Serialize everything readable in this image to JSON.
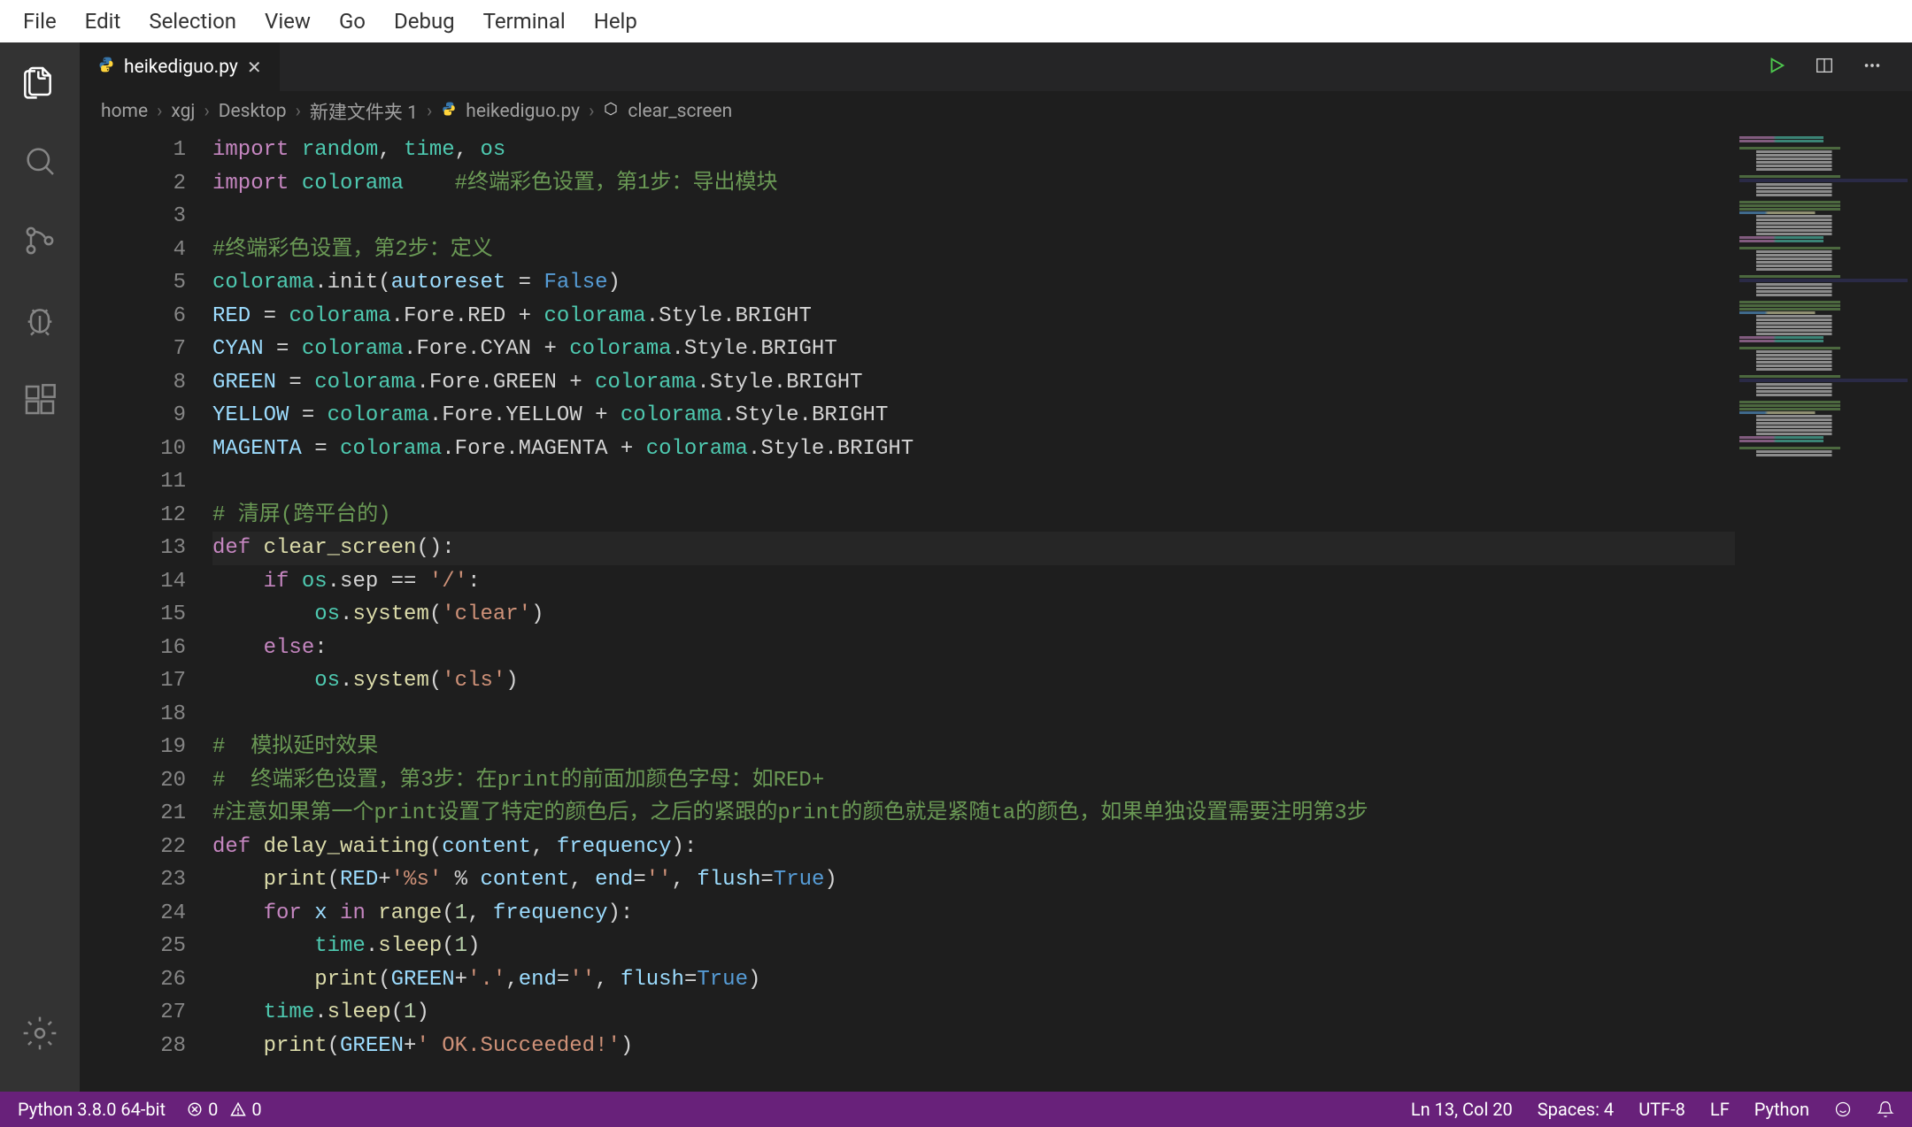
{
  "menubar": [
    "File",
    "Edit",
    "Selection",
    "View",
    "Go",
    "Debug",
    "Terminal",
    "Help"
  ],
  "tab": {
    "filename": "heikediguo.py"
  },
  "breadcrumb": {
    "parts": [
      "home",
      "xgj",
      "Desktop",
      "新建文件夹 1"
    ],
    "file": "heikediguo.py",
    "symbol": "clear_screen"
  },
  "code": {
    "lines": [
      {
        "n": 1,
        "seg": [
          [
            "kw",
            "import"
          ],
          [
            "op",
            " "
          ],
          [
            "mod",
            "random"
          ],
          [
            "op",
            ", "
          ],
          [
            "mod",
            "time"
          ],
          [
            "op",
            ", "
          ],
          [
            "mod",
            "os"
          ]
        ]
      },
      {
        "n": 2,
        "seg": [
          [
            "kw",
            "import"
          ],
          [
            "op",
            " "
          ],
          [
            "mod",
            "colorama"
          ],
          [
            "op",
            "    "
          ],
          [
            "com",
            "#终端彩色设置，第1步：导出模块"
          ]
        ]
      },
      {
        "n": 3,
        "seg": []
      },
      {
        "n": 4,
        "seg": [
          [
            "com",
            "#终端彩色设置，第2步：定义"
          ]
        ]
      },
      {
        "n": 5,
        "seg": [
          [
            "mod",
            "colorama"
          ],
          [
            "op",
            ".init("
          ],
          [
            "var",
            "autoreset"
          ],
          [
            "op",
            " = "
          ],
          [
            "const",
            "False"
          ],
          [
            "op",
            ")"
          ]
        ]
      },
      {
        "n": 6,
        "seg": [
          [
            "var",
            "RED"
          ],
          [
            "op",
            " = "
          ],
          [
            "mod",
            "colorama"
          ],
          [
            "op",
            ".Fore.RED + "
          ],
          [
            "mod",
            "colorama"
          ],
          [
            "op",
            ".Style.BRIGHT"
          ]
        ]
      },
      {
        "n": 7,
        "seg": [
          [
            "var",
            "CYAN"
          ],
          [
            "op",
            " = "
          ],
          [
            "mod",
            "colorama"
          ],
          [
            "op",
            ".Fore.CYAN + "
          ],
          [
            "mod",
            "colorama"
          ],
          [
            "op",
            ".Style.BRIGHT"
          ]
        ]
      },
      {
        "n": 8,
        "seg": [
          [
            "var",
            "GREEN"
          ],
          [
            "op",
            " = "
          ],
          [
            "mod",
            "colorama"
          ],
          [
            "op",
            ".Fore.GREEN + "
          ],
          [
            "mod",
            "colorama"
          ],
          [
            "op",
            ".Style.BRIGHT"
          ]
        ]
      },
      {
        "n": 9,
        "seg": [
          [
            "var",
            "YELLOW"
          ],
          [
            "op",
            " = "
          ],
          [
            "mod",
            "colorama"
          ],
          [
            "op",
            ".Fore.YELLOW + "
          ],
          [
            "mod",
            "colorama"
          ],
          [
            "op",
            ".Style.BRIGHT"
          ]
        ]
      },
      {
        "n": 10,
        "seg": [
          [
            "var",
            "MAGENTA"
          ],
          [
            "op",
            " = "
          ],
          [
            "mod",
            "colorama"
          ],
          [
            "op",
            ".Fore.MAGENTA + "
          ],
          [
            "mod",
            "colorama"
          ],
          [
            "op",
            ".Style.BRIGHT"
          ]
        ]
      },
      {
        "n": 11,
        "seg": []
      },
      {
        "n": 12,
        "seg": [
          [
            "com",
            "# 清屏(跨平台的)"
          ]
        ]
      },
      {
        "n": 13,
        "current": true,
        "seg": [
          [
            "kw",
            "def"
          ],
          [
            "op",
            " "
          ],
          [
            "fn",
            "clear_screen"
          ],
          [
            "op",
            "():"
          ]
        ]
      },
      {
        "n": 14,
        "seg": [
          [
            "op",
            "    "
          ],
          [
            "kw",
            "if"
          ],
          [
            "op",
            " "
          ],
          [
            "mod",
            "os"
          ],
          [
            "op",
            ".sep == "
          ],
          [
            "str",
            "'/'"
          ],
          [
            "op",
            ":"
          ]
        ]
      },
      {
        "n": 15,
        "seg": [
          [
            "op",
            "        "
          ],
          [
            "mod",
            "os"
          ],
          [
            "op",
            "."
          ],
          [
            "fn",
            "system"
          ],
          [
            "op",
            "("
          ],
          [
            "str",
            "'clear'"
          ],
          [
            "op",
            ")"
          ]
        ]
      },
      {
        "n": 16,
        "seg": [
          [
            "op",
            "    "
          ],
          [
            "kw",
            "else"
          ],
          [
            "op",
            ":"
          ]
        ]
      },
      {
        "n": 17,
        "seg": [
          [
            "op",
            "        "
          ],
          [
            "mod",
            "os"
          ],
          [
            "op",
            "."
          ],
          [
            "fn",
            "system"
          ],
          [
            "op",
            "("
          ],
          [
            "str",
            "'cls'"
          ],
          [
            "op",
            ")"
          ]
        ]
      },
      {
        "n": 18,
        "seg": []
      },
      {
        "n": 19,
        "seg": [
          [
            "com",
            "#  模拟延时效果"
          ]
        ]
      },
      {
        "n": 20,
        "seg": [
          [
            "com",
            "#  终端彩色设置，第3步：在print的前面加颜色字母：如RED+"
          ]
        ]
      },
      {
        "n": 21,
        "seg": [
          [
            "com",
            "#注意如果第一个print设置了特定的颜色后，之后的紧跟的print的颜色就是紧随ta的颜色，如果单独设置需要注明第3步"
          ]
        ]
      },
      {
        "n": 22,
        "seg": [
          [
            "kw",
            "def"
          ],
          [
            "op",
            " "
          ],
          [
            "fn",
            "delay_waiting"
          ],
          [
            "op",
            "("
          ],
          [
            "var",
            "content"
          ],
          [
            "op",
            ", "
          ],
          [
            "var",
            "frequency"
          ],
          [
            "op",
            "):"
          ]
        ]
      },
      {
        "n": 23,
        "seg": [
          [
            "op",
            "    "
          ],
          [
            "builtin",
            "print"
          ],
          [
            "op",
            "("
          ],
          [
            "var",
            "RED"
          ],
          [
            "op",
            "+"
          ],
          [
            "str",
            "'%s'"
          ],
          [
            "op",
            " % "
          ],
          [
            "var",
            "content"
          ],
          [
            "op",
            ", "
          ],
          [
            "var",
            "end"
          ],
          [
            "op",
            "="
          ],
          [
            "str",
            "''"
          ],
          [
            "op",
            ", "
          ],
          [
            "var",
            "flush"
          ],
          [
            "op",
            "="
          ],
          [
            "const",
            "True"
          ],
          [
            "op",
            ")"
          ]
        ]
      },
      {
        "n": 24,
        "seg": [
          [
            "op",
            "    "
          ],
          [
            "kw",
            "for"
          ],
          [
            "op",
            " "
          ],
          [
            "var",
            "x"
          ],
          [
            "op",
            " "
          ],
          [
            "kw",
            "in"
          ],
          [
            "op",
            " "
          ],
          [
            "builtin",
            "range"
          ],
          [
            "op",
            "("
          ],
          [
            "num",
            "1"
          ],
          [
            "op",
            ", "
          ],
          [
            "var",
            "frequency"
          ],
          [
            "op",
            "):"
          ]
        ]
      },
      {
        "n": 25,
        "seg": [
          [
            "op",
            "        "
          ],
          [
            "mod",
            "time"
          ],
          [
            "op",
            "."
          ],
          [
            "fn",
            "sleep"
          ],
          [
            "op",
            "("
          ],
          [
            "num",
            "1"
          ],
          [
            "op",
            ")"
          ]
        ]
      },
      {
        "n": 26,
        "seg": [
          [
            "op",
            "        "
          ],
          [
            "builtin",
            "print"
          ],
          [
            "op",
            "("
          ],
          [
            "var",
            "GREEN"
          ],
          [
            "op",
            "+"
          ],
          [
            "str",
            "'.'"
          ],
          [
            "op",
            ","
          ],
          [
            "var",
            "end"
          ],
          [
            "op",
            "="
          ],
          [
            "str",
            "''"
          ],
          [
            "op",
            ", "
          ],
          [
            "var",
            "flush"
          ],
          [
            "op",
            "="
          ],
          [
            "const",
            "True"
          ],
          [
            "op",
            ")"
          ]
        ]
      },
      {
        "n": 27,
        "seg": [
          [
            "op",
            "    "
          ],
          [
            "mod",
            "time"
          ],
          [
            "op",
            "."
          ],
          [
            "fn",
            "sleep"
          ],
          [
            "op",
            "("
          ],
          [
            "num",
            "1"
          ],
          [
            "op",
            ")"
          ]
        ]
      },
      {
        "n": 28,
        "seg": [
          [
            "op",
            "    "
          ],
          [
            "builtin",
            "print"
          ],
          [
            "op",
            "("
          ],
          [
            "var",
            "GREEN"
          ],
          [
            "op",
            "+"
          ],
          [
            "str",
            "' OK.Succeeded!'"
          ],
          [
            "op",
            ")"
          ]
        ]
      }
    ]
  },
  "status": {
    "interpreter": "Python 3.8.0 64-bit",
    "errors": "0",
    "warnings": "0",
    "cursor": "Ln 13, Col 20",
    "spaces": "Spaces: 4",
    "encoding": "UTF-8",
    "eol": "LF",
    "language": "Python"
  }
}
